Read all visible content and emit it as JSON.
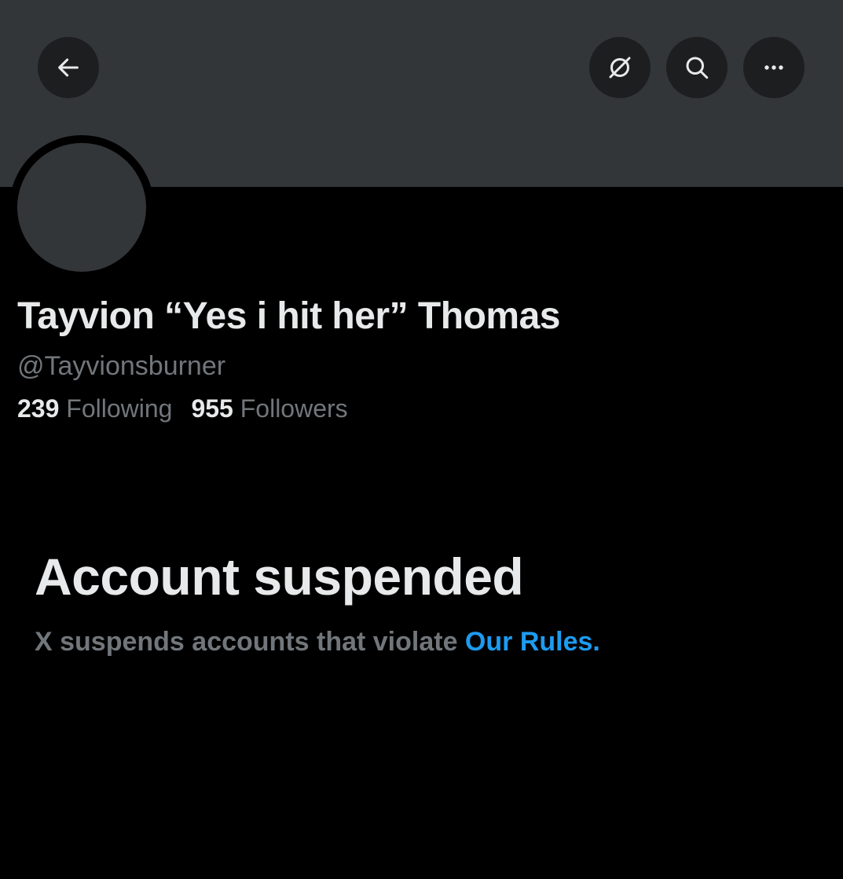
{
  "header": {
    "back_icon": "arrow-left-icon",
    "translate_icon": "translate-icon",
    "search_icon": "search-icon",
    "more_icon": "ellipsis-icon"
  },
  "profile": {
    "display_name": "Tayvion “Yes i hit her” Thomas",
    "handle": "@Tayvionsburner",
    "following_count": "239",
    "following_label": "Following",
    "followers_count": "955",
    "followers_label": "Followers"
  },
  "suspension": {
    "title": "Account suspended",
    "description": "X suspends accounts that violate ",
    "rules_link": "Our Rules."
  },
  "colors": {
    "background": "#000000",
    "banner": "#333639",
    "primary_text": "#e7e9ea",
    "secondary_text": "#71767b",
    "link": "#1d9bf0"
  }
}
